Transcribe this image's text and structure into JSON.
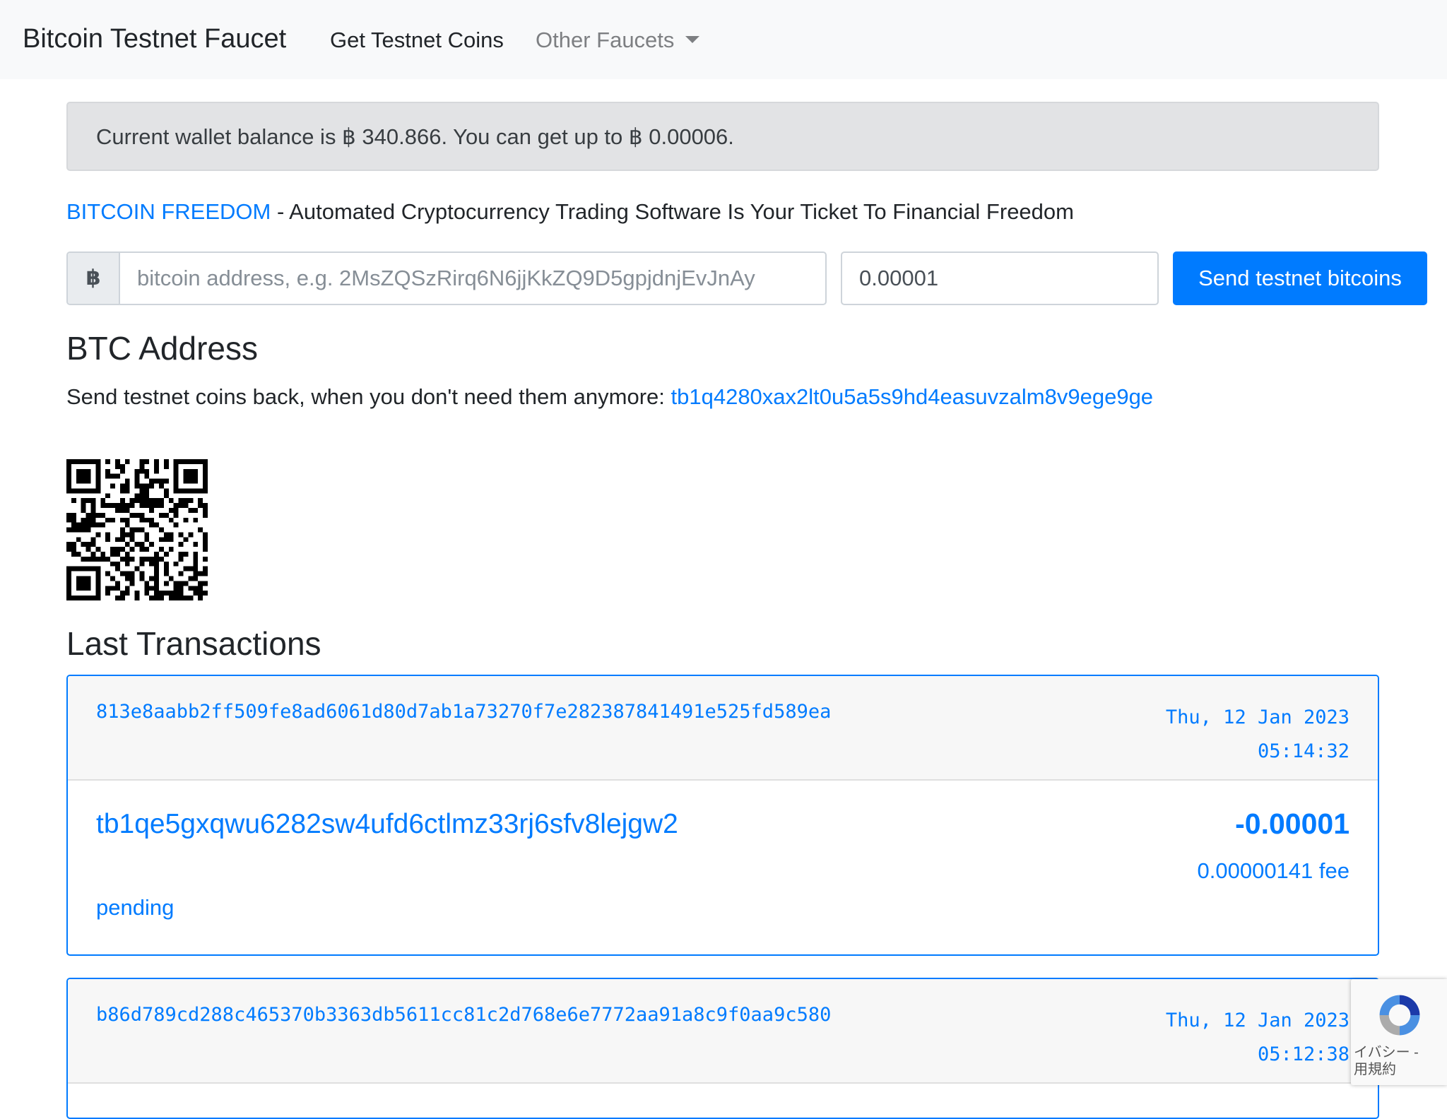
{
  "navbar": {
    "brand": "Bitcoin Testnet Faucet",
    "items": [
      {
        "label": "Get Testnet Coins",
        "active": true
      },
      {
        "label": "Other Faucets",
        "dropdown": true
      }
    ]
  },
  "alert": {
    "text": "Current wallet balance is ฿ 340.866. You can get up to ฿ 0.00006."
  },
  "promo": {
    "link": "BITCOIN FREEDOM",
    "text": " - Automated Cryptocurrency Trading Software Is Your Ticket To Financial Freedom"
  },
  "form": {
    "currency_symbol": "฿",
    "address_placeholder": "bitcoin address, e.g. 2MsZQSzRirq6N6jjKkZQ9D5gpjdnjEvJnAy",
    "amount_value": "0.00001",
    "send_label": "Send testnet bitcoins"
  },
  "btc_address": {
    "heading": "BTC Address",
    "text": "Send testnet coins back, when you don't need them anymore: ",
    "address": "tb1q4280xax2lt0u5a5s9hd4easuvzalm8v9ege9ge"
  },
  "transactions": {
    "heading": "Last Transactions",
    "items": [
      {
        "hash": "813e8aabb2ff509fe8ad6061d80d7ab1a73270f7e282387841491e525fd589ea",
        "date_line1": "Thu, 12 Jan 2023",
        "date_line2": "05:14:32",
        "address": "tb1qe5gxqwu6282sw4ufd6ctlmz33rj6sfv8lejgw2",
        "status": "pending",
        "amount": "-0.00001",
        "fee": "0.00000141 fee"
      },
      {
        "hash": "b86d789cd288c465370b3363db5611cc81c2d768e6e7772aa91a8c9f0aa9c580",
        "date_line1": "Thu, 12 Jan 2023",
        "date_line2": "05:12:38"
      }
    ]
  },
  "recaptcha": {
    "line1": "イバシー -",
    "line2": "用規約"
  }
}
